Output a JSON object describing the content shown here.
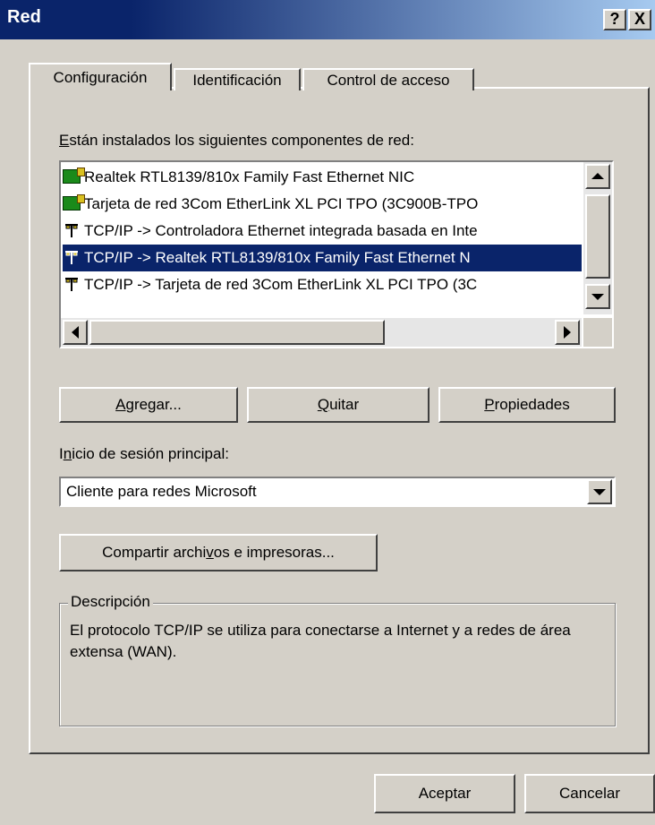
{
  "window": {
    "title": "Red"
  },
  "titlebar_buttons": {
    "help": "?",
    "close": "X"
  },
  "tabs": [
    {
      "label": "Configuración",
      "active": true
    },
    {
      "label": "Identificación",
      "active": false
    },
    {
      "label": "Control de acceso",
      "active": false
    }
  ],
  "components": {
    "label_pre": "",
    "label_key": "E",
    "label_post": "stán instalados los siguientes componentes de red:",
    "items": [
      {
        "icon": "network-adapter-icon",
        "text": "Realtek RTL8139/810x Family Fast Ethernet NIC",
        "selected": false
      },
      {
        "icon": "network-adapter-icon",
        "text": "Tarjeta de red 3Com EtherLink XL PCI TPO (3C900B-TPO",
        "selected": false
      },
      {
        "icon": "protocol-icon",
        "text": "TCP/IP -> Controladora Ethernet integrada basada en Inte",
        "selected": false
      },
      {
        "icon": "protocol-icon",
        "text": "TCP/IP -> Realtek RTL8139/810x Family Fast Ethernet N",
        "selected": true
      },
      {
        "icon": "protocol-icon",
        "text": "TCP/IP -> Tarjeta de red 3Com EtherLink XL PCI TPO (3C",
        "selected": false
      }
    ]
  },
  "buttons": {
    "add_key": "A",
    "add_rest": "gregar...",
    "remove_key": "Q",
    "remove_rest": "uitar",
    "props_key": "P",
    "props_rest": "ropiedades",
    "share_pre": "Compartir archi",
    "share_key": "v",
    "share_post": "os e impresoras...",
    "ok": "Aceptar",
    "cancel": "Cancelar"
  },
  "logon": {
    "label_pre": "I",
    "label_key": "n",
    "label_post": "icio de sesión principal:",
    "selected": "Cliente para redes Microsoft"
  },
  "description": {
    "legend": "Descripción",
    "text": "El protocolo TCP/IP se utiliza para conectarse a Internet y a redes de área extensa (WAN)."
  },
  "colors": {
    "titlebar": "#0a246a",
    "face": "#d4d0c8",
    "selection": "#0a246a"
  }
}
